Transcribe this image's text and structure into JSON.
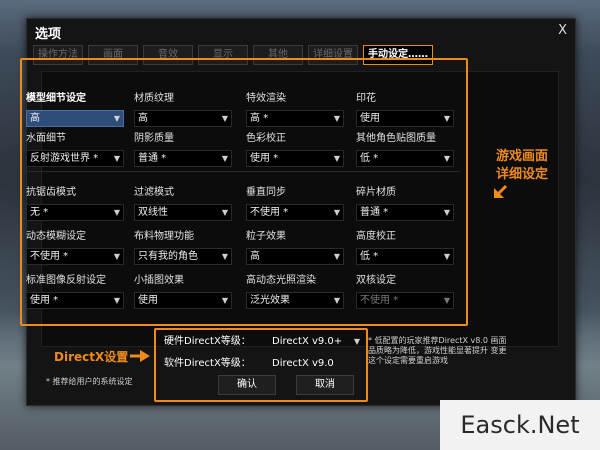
{
  "window": {
    "title": "选项",
    "close_symbol": "X"
  },
  "tabs": [
    {
      "label": "操作方法"
    },
    {
      "label": "画面"
    },
    {
      "label": "音效"
    },
    {
      "label": "显示"
    },
    {
      "label": "其他"
    },
    {
      "label": "详细设置"
    },
    {
      "label": "手动设定……"
    }
  ],
  "active_tab_index": 6,
  "settings": [
    [
      {
        "label": "模型细节设定",
        "value": "高"
      },
      {
        "label": "材质纹理",
        "value": "高"
      },
      {
        "label": "特效渲染",
        "value": "高 *"
      },
      {
        "label": "印花",
        "value": "使用"
      }
    ],
    [
      {
        "label": "水面细节",
        "value": "反射游戏世界 *"
      },
      {
        "label": "阴影质量",
        "value": "普通 *"
      },
      {
        "label": "色彩校正",
        "value": "使用 *"
      },
      {
        "label": "其他角色贴图质量",
        "value": "低 *"
      }
    ],
    [
      {
        "label": "抗锯齿模式",
        "value": "无 *"
      },
      {
        "label": "过滤模式",
        "value": "双线性"
      },
      {
        "label": "垂直同步",
        "value": "不使用 *"
      },
      {
        "label": "碎片材质",
        "value": "普通 *"
      }
    ],
    [
      {
        "label": "动态模糊设定",
        "value": "不使用 *"
      },
      {
        "label": "布料物理功能",
        "value": "只有我的角色"
      },
      {
        "label": "粒子效果",
        "value": "高"
      },
      {
        "label": "高度校正",
        "value": "低 *"
      }
    ],
    [
      {
        "label": "标准图像反射设定",
        "value": "使用 *"
      },
      {
        "label": "小插图效果",
        "value": "使用"
      },
      {
        "label": "高动态光照渲染",
        "value": "泛光效果"
      },
      {
        "label": "双核设定",
        "value": "不使用 *",
        "disabled": true
      }
    ]
  ],
  "directx": {
    "hardware_label": "硬件DirectX等级：",
    "hardware_value": "DirectX v9.0+",
    "software_label": "软件DirectX等级：",
    "software_value": "DirectX v9.0",
    "confirm_label": "确认",
    "cancel_label": "取消"
  },
  "notes": {
    "left": "* 推荐给用户的系统设定",
    "right": "* 低配置的玩家推荐DirectX v8.0 画面品质略为降低，游戏性能显著提升 变更这个设定需要重启游戏"
  },
  "annotations": {
    "game_detail_line1": "游戏画面",
    "game_detail_line2": "详细设定",
    "directx": "DirectX设置"
  },
  "watermark": "Easck.Net",
  "colors": {
    "accent": "#f08a1a",
    "selected_bg": "#2e4d7a"
  }
}
